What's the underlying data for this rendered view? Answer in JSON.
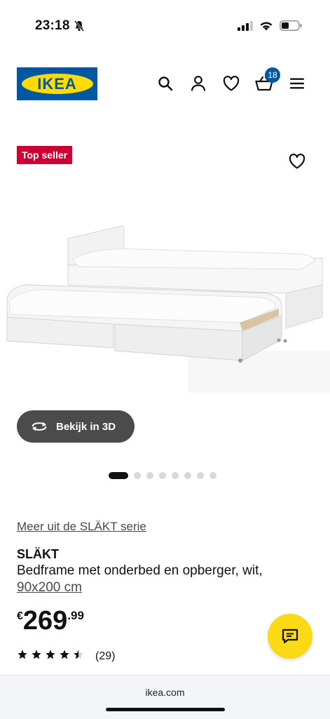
{
  "status_bar": {
    "time": "23:18"
  },
  "header": {
    "logo_text": "IKEA",
    "cart_count": "18"
  },
  "product": {
    "badge": "Top seller",
    "view_3d_label": "Bekijk in 3D",
    "series_link": "Meer uit de SLÄKT serie",
    "name": "SLÄKT",
    "description": "Bedframe met onderbed en opberger, wit,",
    "size": "90x200 cm",
    "price": {
      "currency": "€",
      "integer": "269",
      "decimal": ".99"
    },
    "rating": {
      "stars": 4.5,
      "max": 5,
      "count": "(29)"
    },
    "carousel": {
      "total": 8,
      "active": 1
    }
  },
  "browser": {
    "url": "ikea.com"
  },
  "colors": {
    "brand_blue": "#0058a3",
    "brand_yellow": "#ffdb00",
    "badge_red": "#cc0033",
    "chat_yellow": "#fbd914"
  }
}
